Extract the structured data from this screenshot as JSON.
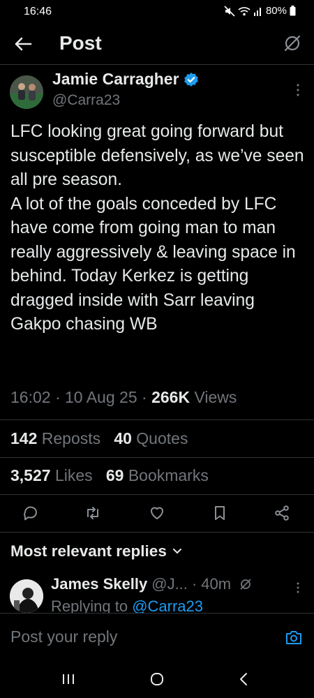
{
  "status_bar": {
    "time": "16:46",
    "battery": "80%",
    "icons": [
      "mute-icon",
      "wifi-icon",
      "signal-icon",
      "battery-icon"
    ]
  },
  "header": {
    "title": "Post",
    "back_icon": "back-arrow-icon",
    "grok_icon": "grok-icon"
  },
  "post": {
    "author_name": "Jamie Carragher",
    "author_handle": "@Carra23",
    "verified": true,
    "text": "LFC looking great going forward but susceptible defensively, as we’ve seen all pre season.\nA lot of the goals conceded by LFC  have come from going man to man really aggressively & leaving space in behind. Today Kerkez is getting dragged inside with Sarr leaving Gakpo chasing WB",
    "time": "16:02",
    "date": "10 Aug 25",
    "views_count": "266K",
    "views_label": "Views",
    "reposts_count": "142",
    "reposts_label": "Reposts",
    "quotes_count": "40",
    "quotes_label": "Quotes",
    "likes_count": "3,527",
    "likes_label": "Likes",
    "bookmarks_count": "69",
    "bookmarks_label": "Bookmarks"
  },
  "replies": {
    "header": "Most relevant replies",
    "items": [
      {
        "name": "James Skelly",
        "handle": "@J...",
        "age": "40m",
        "replying_prefix": "Replying to",
        "replying_to": "@Carra23"
      }
    ]
  },
  "composer": {
    "placeholder": "Post your reply"
  },
  "colors": {
    "background": "#000000",
    "text": "#e7e9ea",
    "secondary": "#71767b",
    "accent": "#1d9bf0",
    "divider": "#2f3336"
  }
}
